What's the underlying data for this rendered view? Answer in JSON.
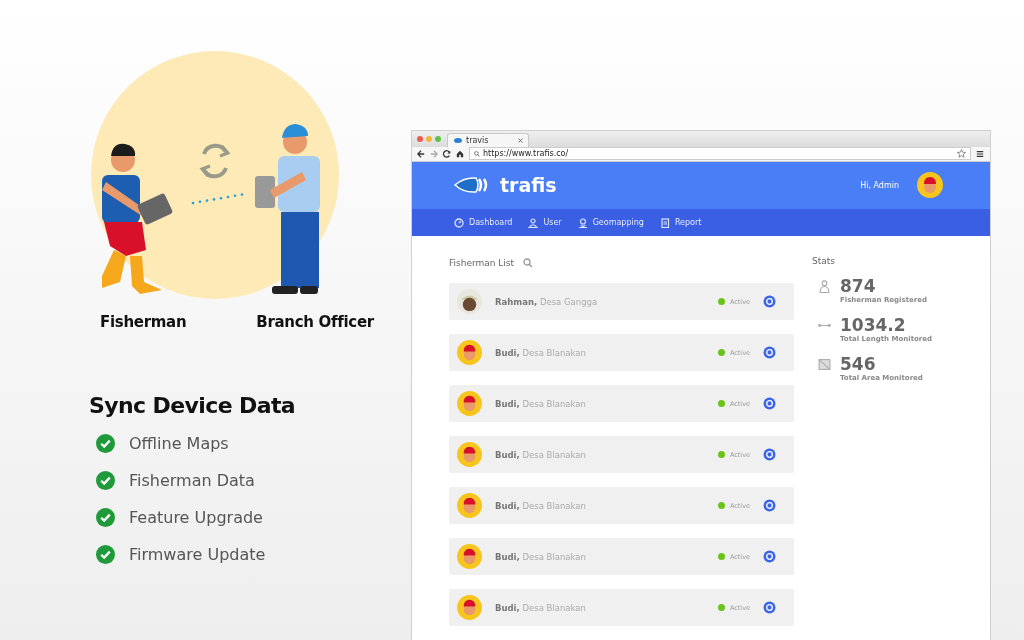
{
  "illustration": {
    "labels": [
      "Fisherman",
      "Branch Officer"
    ]
  },
  "feature": {
    "title": "Sync Device Data",
    "items": [
      {
        "label": "Offline Maps",
        "checked": true
      },
      {
        "label": "Fisherman Data",
        "checked": true
      },
      {
        "label": "Feature Upgrade",
        "checked": true
      },
      {
        "label": "Firmware Update",
        "checked": true
      }
    ]
  },
  "browser": {
    "tab_title": "travis",
    "url": "https://www.trafis.co/"
  },
  "app": {
    "brand": "trafis",
    "greeting": "Hi, Admin",
    "nav": [
      {
        "label": "Dashboard",
        "kind": "dashboard"
      },
      {
        "label": "User",
        "kind": "user"
      },
      {
        "label": "Geomapping",
        "kind": "geo"
      },
      {
        "label": "Report",
        "kind": "report"
      }
    ],
    "list_title": "Fisherman List",
    "fishermen": [
      {
        "name": "Rahman,",
        "village": "Desa Gangga",
        "status": "Active",
        "kind": "photo"
      },
      {
        "name": "Budi,",
        "village": "Desa Blanakan",
        "status": "Active",
        "kind": "cartoon"
      },
      {
        "name": "Budi,",
        "village": "Desa Blanakan",
        "status": "Active",
        "kind": "cartoon"
      },
      {
        "name": "Budi,",
        "village": "Desa Blanakan",
        "status": "Active",
        "kind": "cartoon"
      },
      {
        "name": "Budi,",
        "village": "Desa Blanakan",
        "status": "Active",
        "kind": "cartoon"
      },
      {
        "name": "Budi,",
        "village": "Desa Blanakan",
        "status": "Active",
        "kind": "cartoon"
      },
      {
        "name": "Budi,",
        "village": "Desa Blanakan",
        "status": "Active",
        "kind": "cartoon"
      }
    ],
    "stats_title": "Stats",
    "stats": [
      {
        "kind": "person",
        "value": "874",
        "label": "Fisherman Registered"
      },
      {
        "kind": "length",
        "value": "1034.2",
        "label": "Total Length Monitored"
      },
      {
        "kind": "area",
        "value": "546",
        "label": "Total Area Monitored"
      }
    ]
  }
}
